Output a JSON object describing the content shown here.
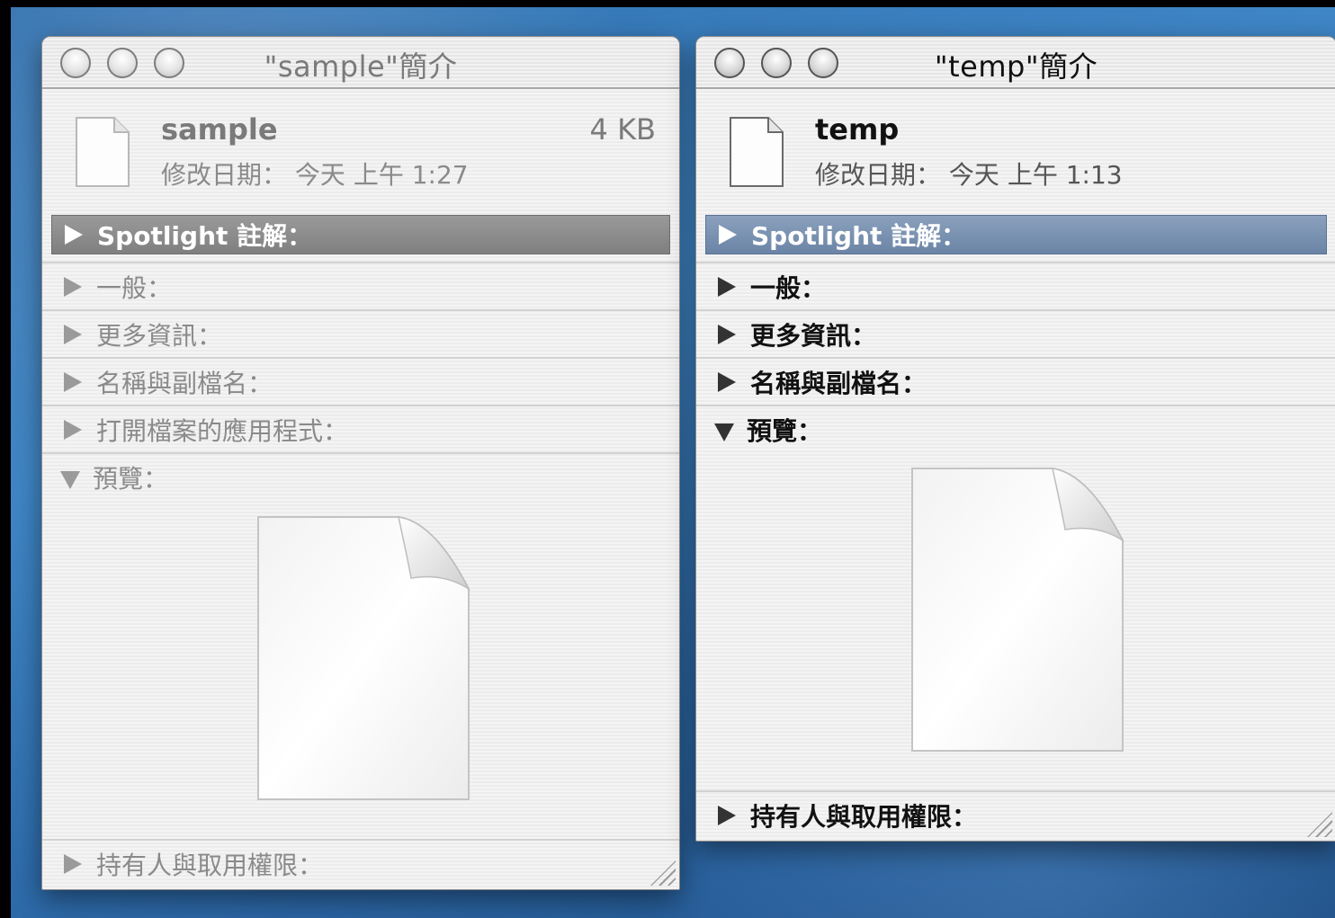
{
  "windows": [
    {
      "id": "sample",
      "title": "\"sample\"簡介",
      "file_name": "sample",
      "file_size": "4 KB",
      "modified_label": "修改日期：",
      "modified_value": "今天 上午 1:27",
      "spotlight": "Spotlight 註解：",
      "sections": [
        "一般：",
        "更多資訊：",
        "名稱與副檔名：",
        "打開檔案的應用程式：",
        "預覽："
      ],
      "footer": "持有人與取用權限："
    },
    {
      "id": "temp",
      "title": "\"temp\"簡介",
      "file_name": "temp",
      "modified_label": "修改日期：",
      "modified_value": "今天 上午 1:13",
      "spotlight": "Spotlight 註解：",
      "sections": [
        "一般：",
        "更多資訊：",
        "名稱與副檔名：",
        "預覽："
      ],
      "footer": "持有人與取用權限："
    }
  ],
  "icons": [
    "document-icon",
    "preview-document-icon",
    "disclosure-triangle-icon",
    "resize-grip-icon"
  ]
}
